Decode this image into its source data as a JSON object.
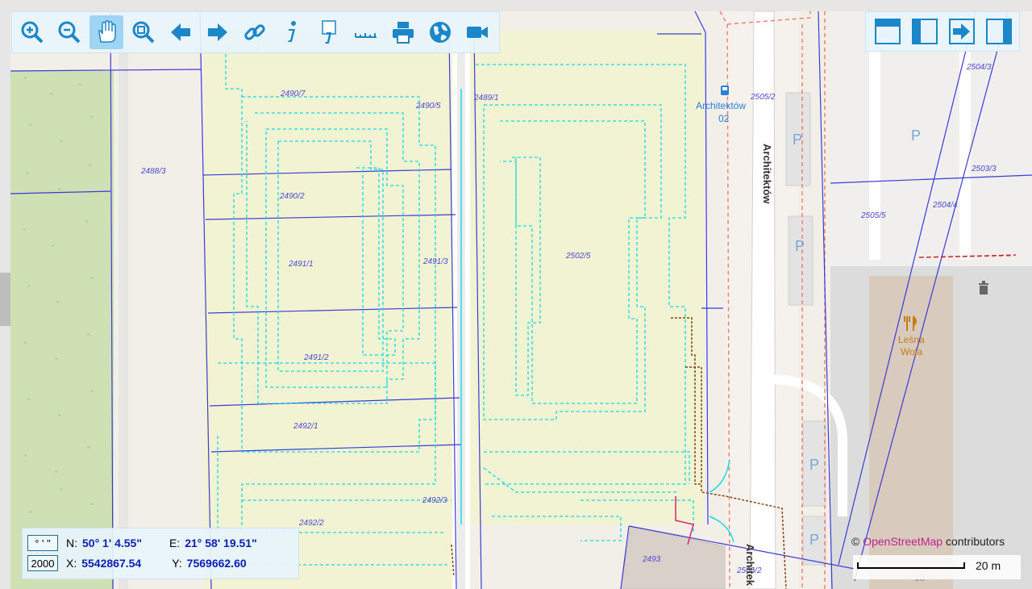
{
  "toolbar": {
    "buttons": [
      {
        "name": "zoom-in",
        "icon": "zoom-in-icon"
      },
      {
        "name": "zoom-out",
        "icon": "zoom-out-icon"
      },
      {
        "name": "pan",
        "icon": "hand-icon",
        "active": true
      },
      {
        "name": "zoom-box",
        "icon": "zoom-rect-icon"
      },
      {
        "name": "back",
        "icon": "arrow-left-icon"
      },
      {
        "name": "forward",
        "icon": "arrow-right-icon"
      },
      {
        "name": "link",
        "icon": "link-icon"
      },
      {
        "name": "info",
        "icon": "info-icon"
      },
      {
        "name": "info-document",
        "icon": "info-document-icon"
      },
      {
        "name": "measure",
        "icon": "ruler-icon"
      },
      {
        "name": "print",
        "icon": "printer-icon"
      },
      {
        "name": "globe",
        "icon": "globe-icon"
      },
      {
        "name": "video",
        "icon": "camera-icon"
      }
    ]
  },
  "viewbar": {
    "buttons": [
      {
        "name": "layout-top",
        "icon": "panel-top-icon"
      },
      {
        "name": "layout-left",
        "icon": "panel-left-icon"
      },
      {
        "name": "export",
        "icon": "export-arrow-icon"
      },
      {
        "name": "layout-right",
        "icon": "panel-right-icon"
      }
    ]
  },
  "map": {
    "parcels": [
      "2490/7",
      "2490/5",
      "2489/1",
      "2488/3",
      "2490/2",
      "2491/1",
      "2491/3",
      "2502/5",
      "2491/2",
      "2492/1",
      "2492/3",
      "2492/2",
      "2493",
      "2505/2",
      "2504/3",
      "2503/3",
      "2505/5",
      "2504/4",
      "2505/2"
    ],
    "street_label": "Architektów",
    "street_label_2": "Architek",
    "bus_stop_line1": "Architektów",
    "bus_stop_line2": "02",
    "parking_symbol": "P",
    "restaurant_line1": "Leśna",
    "restaurant_line2": "Wola",
    "house_number": "13",
    "colors": {
      "grass": "#cfe0b4",
      "plot": "#f1f3d3",
      "parcel_line": "#3b3bd6",
      "utility": "#19d9e3",
      "boundary_dashed": "#f08070",
      "road": "#ffffff",
      "parking": "#e3e3e3",
      "pipe": "#8b4513"
    }
  },
  "coords": {
    "format_button": "° ' \"",
    "scale_button": "2000",
    "n_label": "N:",
    "n_value": "50° 1' 4.55\"",
    "e_label": "E:",
    "e_value": "21° 58' 19.51\"",
    "x_label": "X:",
    "x_value": "5542867.54",
    "y_label": "Y:",
    "y_value": "7569662.60"
  },
  "attribution": {
    "prefix": "©",
    "link": "OpenStreetMap",
    "suffix": "contributors"
  },
  "scale": {
    "label": "20 m"
  }
}
